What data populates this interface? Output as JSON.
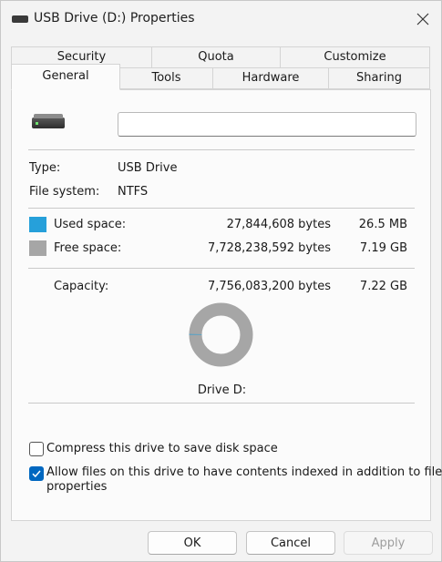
{
  "window": {
    "title": "USB Drive (D:) Properties"
  },
  "tabs": {
    "row1": [
      {
        "label": "Security"
      },
      {
        "label": "Quota"
      },
      {
        "label": "Customize"
      }
    ],
    "row2": [
      {
        "label": "General",
        "active": true
      },
      {
        "label": "Tools"
      },
      {
        "label": "Hardware"
      },
      {
        "label": "Sharing"
      }
    ]
  },
  "general": {
    "name_value": "",
    "type_label": "Type:",
    "type_value": "USB Drive",
    "fs_label": "File system:",
    "fs_value": "NTFS",
    "used": {
      "label": "Used space:",
      "bytes": "27,844,608 bytes",
      "size": "26.5 MB",
      "color": "#26a0da"
    },
    "free": {
      "label": "Free space:",
      "bytes": "7,728,238,592 bytes",
      "size": "7.19 GB",
      "color": "#a6a6a6"
    },
    "capacity": {
      "label": "Capacity:",
      "bytes": "7,756,083,200 bytes",
      "size": "7.22 GB"
    },
    "used_fraction": 0.0036,
    "drive_label": "Drive D:",
    "compress": {
      "label": "Compress this drive to save disk space",
      "checked": false
    },
    "index": {
      "label_line1": "Allow files on this drive to have contents indexed in addition to file",
      "label_line2": "properties",
      "checked": true
    }
  },
  "buttons": {
    "ok": "OK",
    "cancel": "Cancel",
    "apply": "Apply"
  },
  "colors": {
    "accent": "#0067c0"
  }
}
